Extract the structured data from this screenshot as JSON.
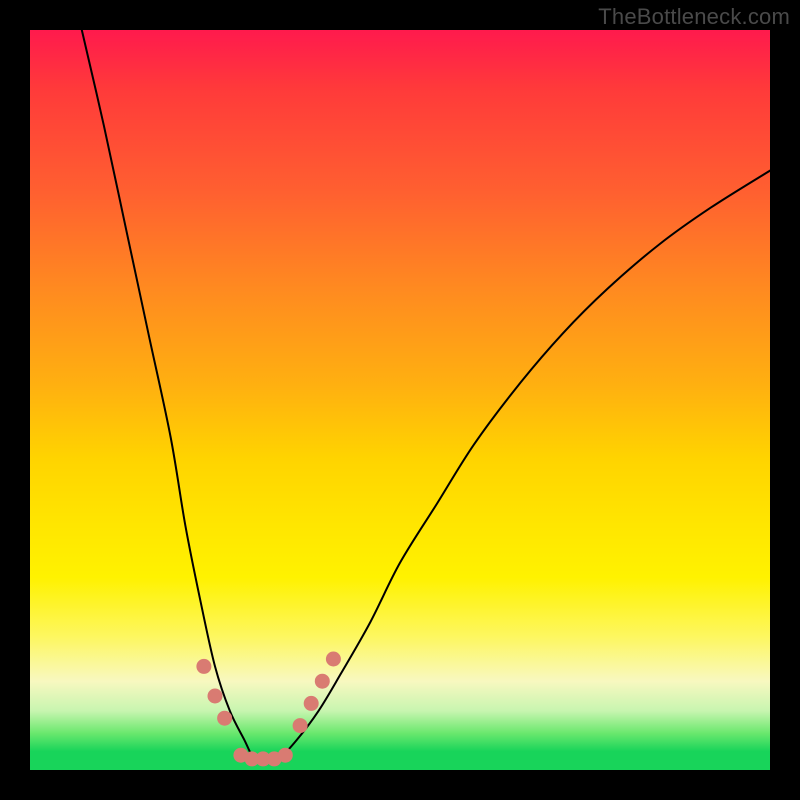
{
  "watermark_text": "TheBottleneck.com",
  "chart_data": {
    "type": "line",
    "title": "",
    "xlabel": "",
    "ylabel": "",
    "xlim": [
      0,
      100
    ],
    "ylim": [
      0,
      100
    ],
    "grid": false,
    "legend": false,
    "comment": "Bottleneck V-curve. Y ≈ bottleneck percentage (color-coded by gradient, green≈0 at bottom to red≈100 at top). X ≈ some swept hardware parameter. Series values read from curve height in plot-percent units (0=bottom green, 100=top red).",
    "series": [
      {
        "name": "bottleneck-curve",
        "x": [
          7,
          10,
          13,
          16,
          19,
          21,
          23,
          25,
          27,
          29,
          30,
          31,
          32,
          34,
          36,
          39,
          42,
          46,
          50,
          55,
          60,
          66,
          72,
          78,
          85,
          92,
          100
        ],
        "values": [
          100,
          87,
          73,
          59,
          45,
          33,
          23,
          14,
          8,
          4,
          2,
          1.5,
          1.5,
          2,
          4,
          8,
          13,
          20,
          28,
          36,
          44,
          52,
          59,
          65,
          71,
          76,
          81
        ]
      }
    ],
    "bulge_markers": {
      "comment": "Thick salmon dotted segments near the valley floor",
      "color": "#d97b72",
      "segments": [
        {
          "x": [
            23.5,
            25.0,
            26.3
          ],
          "values": [
            14,
            10,
            7
          ]
        },
        {
          "x": [
            28.5,
            30.0,
            31.5,
            33.0,
            34.5
          ],
          "values": [
            2,
            1.5,
            1.5,
            1.5,
            2
          ]
        },
        {
          "x": [
            36.5,
            38.0,
            39.5,
            41.0
          ],
          "values": [
            6,
            9,
            12,
            15
          ]
        }
      ]
    }
  }
}
